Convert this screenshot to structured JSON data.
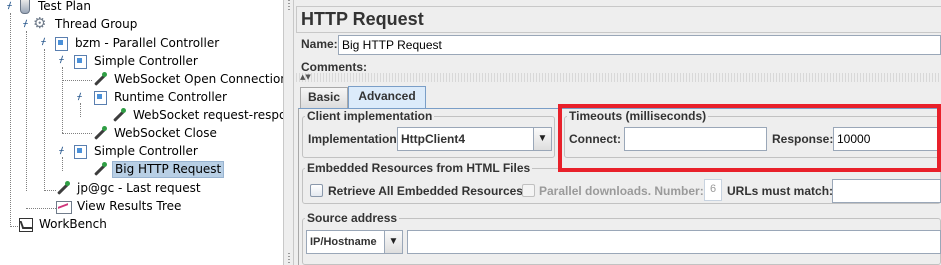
{
  "tree": {
    "nodes": [
      {
        "label": "Test Plan",
        "icon": "flask-icon"
      },
      {
        "label": "Thread Group",
        "icon": "gear-icon"
      },
      {
        "label": "bzm - Parallel Controller",
        "icon": "controller-icon"
      },
      {
        "label": "Simple Controller",
        "icon": "controller-icon"
      },
      {
        "label": "WebSocket Open Connection",
        "icon": "sampler-icon"
      },
      {
        "label": "Runtime Controller",
        "icon": "controller-icon"
      },
      {
        "label": "WebSocket request-response Sampler",
        "icon": "sampler-icon"
      },
      {
        "label": "WebSocket Close",
        "icon": "sampler-icon"
      },
      {
        "label": "Simple Controller",
        "icon": "controller-icon"
      },
      {
        "label": "Big HTTP Request",
        "icon": "sampler-icon"
      },
      {
        "label": "jp@gc - Last request",
        "icon": "sampler-icon"
      },
      {
        "label": "View Results Tree",
        "icon": "graph-icon"
      },
      {
        "label": "WorkBench",
        "icon": "workbench-icon"
      }
    ],
    "selected_index": 9
  },
  "panel": {
    "title": "HTTP Request",
    "name_label": "Name:",
    "name_value": "Big HTTP Request",
    "comments_label": "Comments:",
    "tabs": [
      {
        "label": "Basic",
        "active": false
      },
      {
        "label": "Advanced",
        "active": true
      }
    ],
    "client_impl": {
      "legend": "Client implementation",
      "impl_label": "Implementation:",
      "impl_value": "HttpClient4"
    },
    "timeouts": {
      "legend": "Timeouts (milliseconds)",
      "connect_label": "Connect:",
      "connect_value": "",
      "response_label": "Response:",
      "response_value": "10000"
    },
    "embedded": {
      "legend": "Embedded Resources from HTML Files",
      "retrieve_label": "Retrieve All Embedded Resources",
      "retrieve_checked": false,
      "parallel_label": "Parallel downloads. Number:",
      "parallel_value": "6",
      "urls_label": "URLs must match:",
      "urls_value": ""
    },
    "source": {
      "legend": "Source address",
      "type_value": "IP/Hostname",
      "address_value": ""
    }
  },
  "colors": {
    "highlight": "#e8202a",
    "selection": "#b8cfe5",
    "active_tab": "#dcebfa"
  }
}
